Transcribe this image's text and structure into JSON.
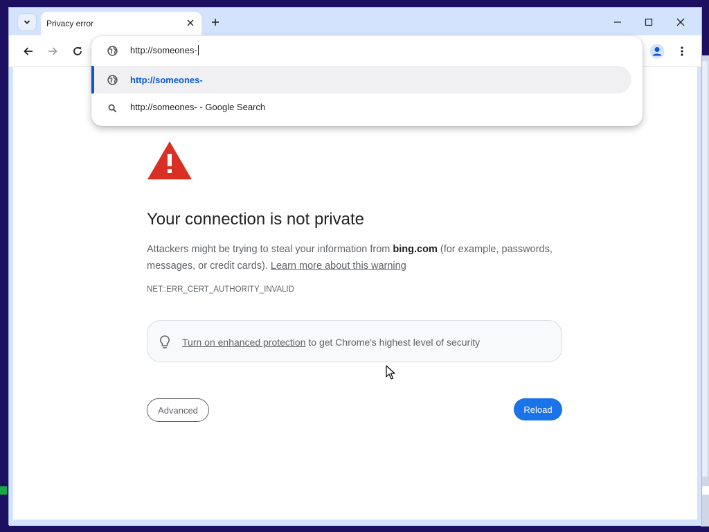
{
  "browser": {
    "tab": {
      "title": "Privacy error"
    },
    "omnibox": {
      "typed_text": "http://someones-",
      "suggestions": [
        {
          "text": "http://someones-",
          "icon": "globe-icon",
          "selected": true
        },
        {
          "text": "http://someones- - Google Search",
          "icon": "search-icon",
          "selected": false
        }
      ]
    }
  },
  "page": {
    "heading": "Your connection is not private",
    "desc_before": "Attackers might be trying to steal your information from ",
    "desc_domain": "bing.com",
    "desc_after": " (for example, passwords, messages, or credit cards). ",
    "learn_more_link": "Learn more about this warning",
    "error_code": "NET::ERR_CERT_AUTHORITY_INVALID",
    "enhanced_link": "Turn on enhanced protection",
    "enhanced_rest": " to get Chrome's highest level of security",
    "advanced_button": "Advanced",
    "reload_button": "Reload"
  },
  "colors": {
    "accent": "#1a73e8",
    "warning": "#d93025",
    "frame": "#d3e3fd"
  }
}
